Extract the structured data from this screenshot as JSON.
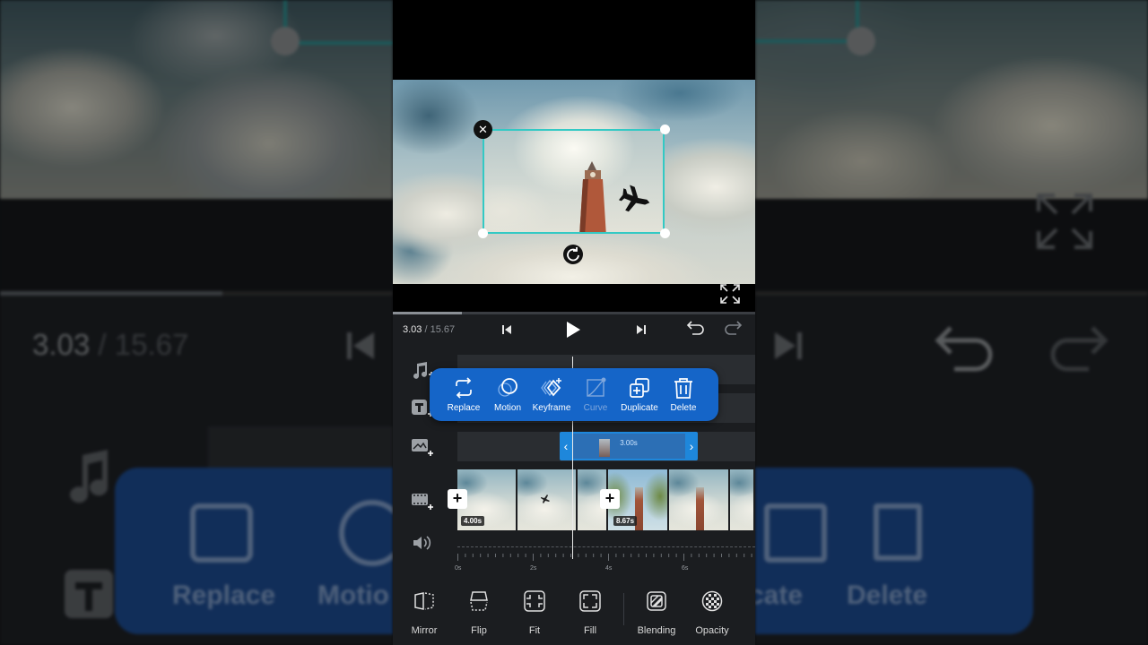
{
  "player": {
    "current_time": "3.03",
    "time_separator": " / ",
    "total_time": "15.67",
    "progress_fraction": 0.19
  },
  "floating_toolbar": {
    "items": [
      {
        "label": "Replace",
        "icon": "replace-icon",
        "enabled": true
      },
      {
        "label": "Motion",
        "icon": "motion-icon",
        "enabled": true
      },
      {
        "label": "Keyframe",
        "icon": "keyframe-icon",
        "enabled": true
      },
      {
        "label": "Curve",
        "icon": "curve-icon",
        "enabled": false
      },
      {
        "label": "Duplicate",
        "icon": "duplicate-icon",
        "enabled": true
      },
      {
        "label": "Delete",
        "icon": "delete-icon",
        "enabled": true
      }
    ],
    "color": "#1565c8"
  },
  "timeline": {
    "track_icons": [
      "music-add-icon",
      "text-add-icon",
      "pip-add-icon",
      "video-add-icon",
      "volume-icon"
    ],
    "pip_clip": {
      "duration": "3.00s"
    },
    "main_clips": [
      {
        "duration": "4.00s"
      },
      {
        "duration": "8.67s"
      }
    ],
    "ruler_ticks": [
      "0s",
      "2s",
      "4s",
      "6s"
    ]
  },
  "bottom_toolbar": {
    "items": [
      {
        "label": "Mirror",
        "icon": "mirror-icon"
      },
      {
        "label": "Flip",
        "icon": "flip-icon"
      },
      {
        "label": "Fit",
        "icon": "fit-icon"
      },
      {
        "label": "Fill",
        "icon": "fill-icon"
      },
      {
        "label": "Blending",
        "icon": "blending-icon"
      },
      {
        "label": "Opacity",
        "icon": "opacity-icon"
      }
    ]
  },
  "background": {
    "zoom_time": "3.03",
    "zoom_total": " / 15.67",
    "zoom_labels": [
      "Replace",
      "Motio",
      "plicate",
      "Delete"
    ]
  },
  "colors": {
    "selection": "#33c9c4",
    "accent_blue": "#1e87db"
  }
}
